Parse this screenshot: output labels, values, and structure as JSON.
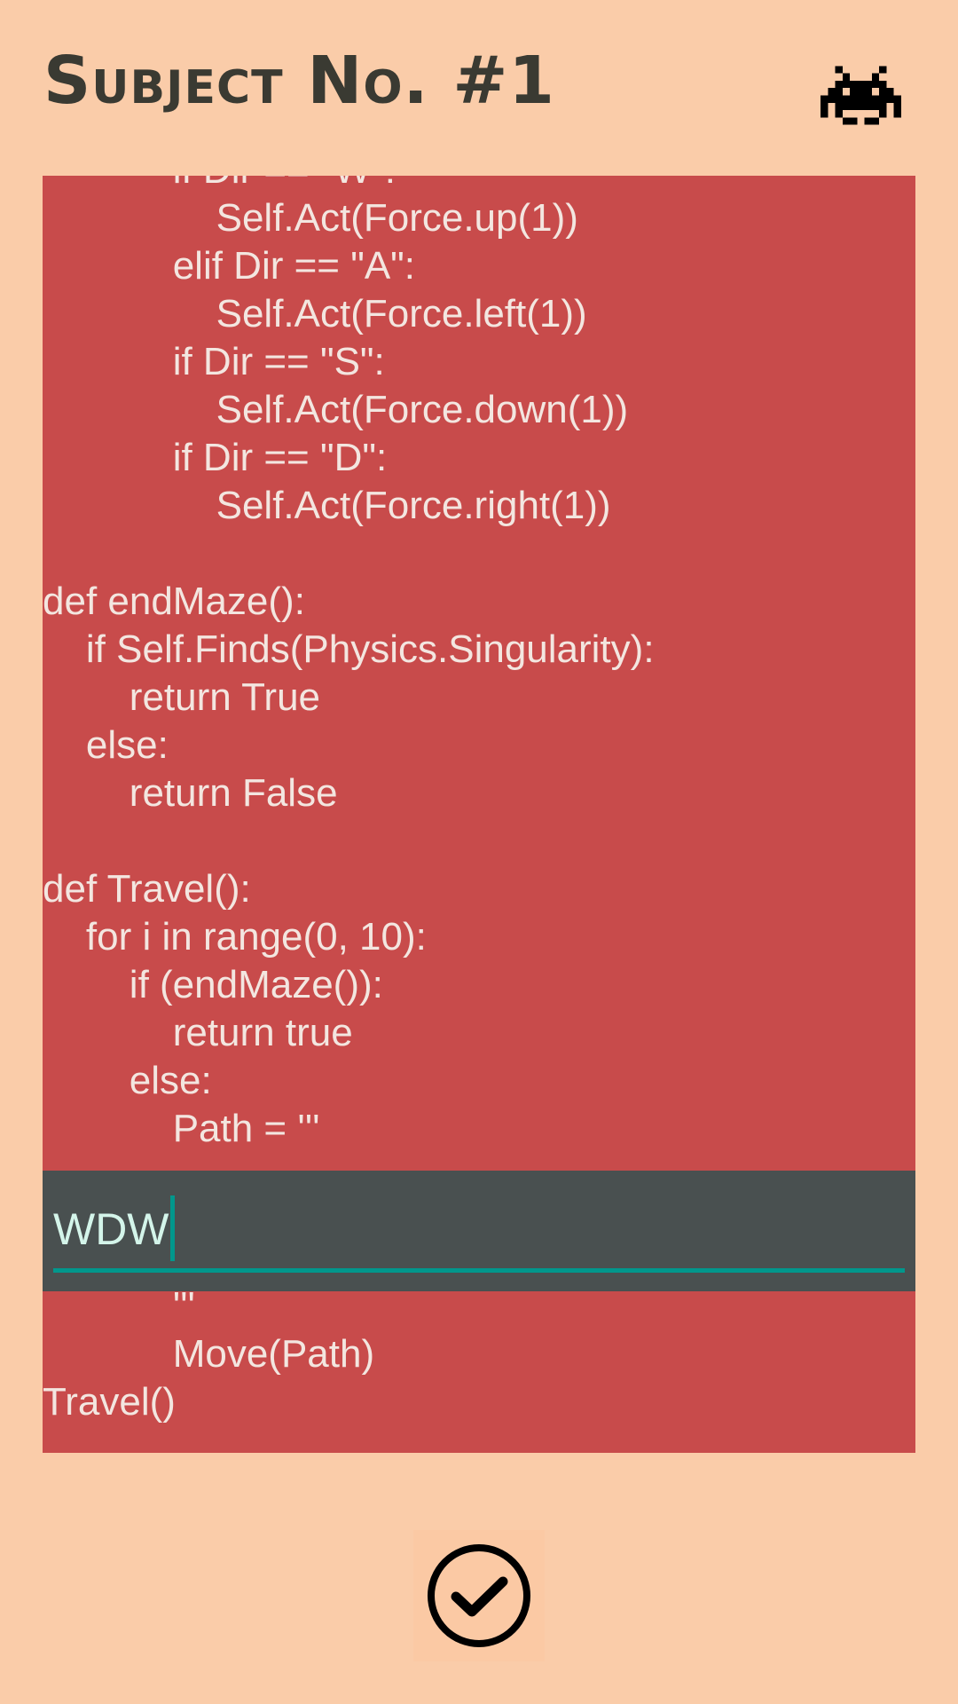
{
  "header": {
    "title": "Subject No. #1",
    "icon": "space-invader-icon"
  },
  "code": {
    "lines_before_input": [
      "            if Dir == \"W\":",
      "                Self.Act(Force.up(1))",
      "            elif Dir == \"A\":",
      "                Self.Act(Force.left(1))",
      "            if Dir == \"S\":",
      "                Self.Act(Force.down(1))",
      "            if Dir == \"D\":",
      "                Self.Act(Force.right(1))",
      "",
      "def endMaze():",
      "    if Self.Finds(Physics.Singularity):",
      "        return True",
      "    else:",
      "        return False",
      "",
      "def Travel():",
      "    for i in range(0, 10):",
      "        if (endMaze()):",
      "            return true",
      "        else:",
      "            Path = '''"
    ],
    "lines_after_input": [
      "            '''",
      "            Move(Path)",
      "Travel()"
    ]
  },
  "input": {
    "value": "WDW"
  },
  "actions": {
    "submit_icon": "check-circle-icon"
  },
  "colors": {
    "background": "#facca9",
    "code_panel": "#c84b4b",
    "code_text": "#f3e6e0",
    "input_band": "#495050",
    "input_text": "#d4f5ea",
    "accent": "#00978c",
    "title": "#3a3a32"
  }
}
